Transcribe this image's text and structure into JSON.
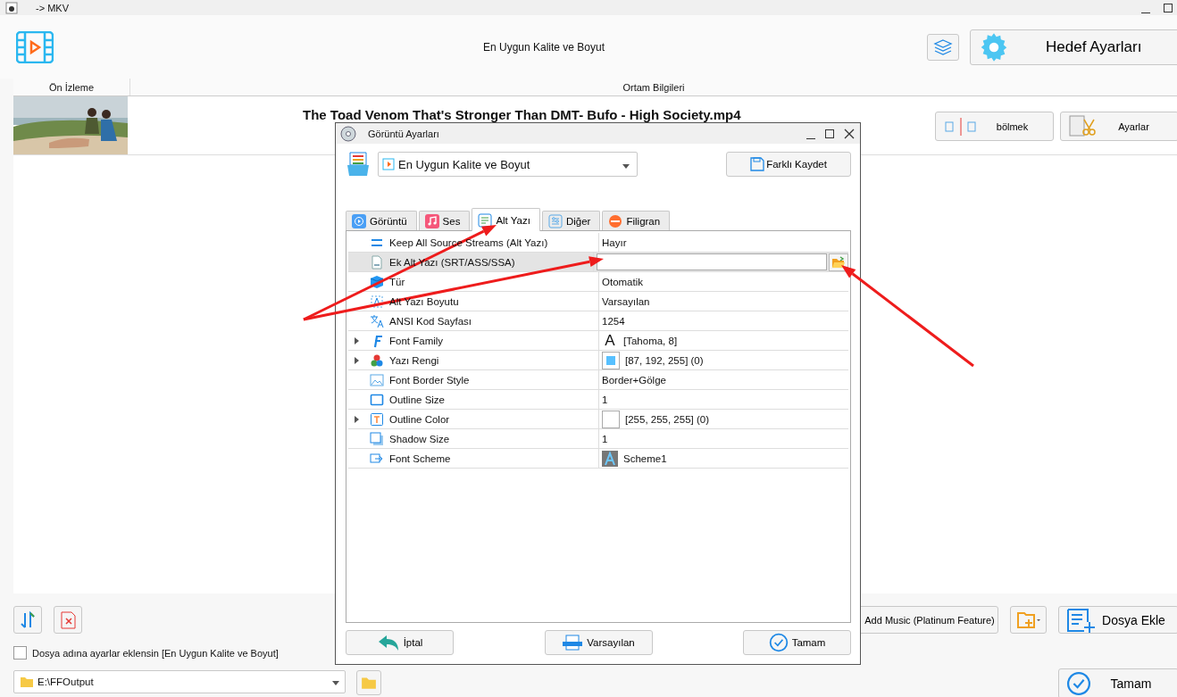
{
  "window": {
    "title": "-> MKV"
  },
  "header": {
    "profile": "En Uygun Kalite ve Boyut",
    "target_button": "Hedef Ayarları"
  },
  "table": {
    "columns": [
      "Ön İzleme",
      "Ortam Bilgileri"
    ],
    "rows": [
      {
        "preview": {
          "kind": "picture"
        },
        "file_name": "The Toad Venom That's Stronger Than DMT- Bufo - High Society.mp4",
        "actions": [
          "bölmek",
          "Ayarlar"
        ]
      }
    ]
  },
  "dialog": {
    "title": "Görüntü Ayarları",
    "preset": "En Uygun Kalite ve Boyut",
    "save_as": "Farklı Kaydet",
    "tabs": [
      {
        "label": "Görüntü",
        "selected": false
      },
      {
        "label": "Ses",
        "selected": false
      },
      {
        "label": "Alt Yazı",
        "selected": true
      },
      {
        "label": "Diğer",
        "selected": false
      },
      {
        "label": "Filigran",
        "selected": false
      }
    ],
    "properties": [
      {
        "kind": "text",
        "name": "Keep All Source Streams (Alt Yazı)",
        "value": "Hayır",
        "expandable": false,
        "selected": false
      },
      {
        "kind": "file",
        "name": "Ek Alt Yazı (SRT/ASS/SSA)",
        "expandable": false,
        "selected": true
      },
      {
        "kind": "text",
        "name": "Tür",
        "value": "Otomatik",
        "expandable": false,
        "selected": false
      },
      {
        "kind": "text",
        "name": "Alt Yazı Boyutu",
        "value": "Varsayılan",
        "expandable": false,
        "selected": false
      },
      {
        "kind": "text",
        "name": "ANSI Kod Sayfası",
        "value": "1254",
        "expandable": false,
        "selected": false
      },
      {
        "kind": "font",
        "name": "Font Family",
        "value": "[Tahoma, 8]",
        "glyph": "A",
        "expandable": true,
        "selected": false
      },
      {
        "kind": "swatch",
        "name": "Yazı Rengi",
        "value": "[87, 192, 255] (0)",
        "color": "#57c0ff",
        "expandable": true,
        "selected": false
      },
      {
        "kind": "text",
        "name": "Font Border Style",
        "value": "Border+Gölge",
        "expandable": false,
        "selected": false
      },
      {
        "kind": "text",
        "name": "Outline Size",
        "value": "1",
        "expandable": false,
        "selected": false
      },
      {
        "kind": "swatch",
        "name": "Outline Color",
        "value": "[255, 255, 255] (0)",
        "color": "#ffffff",
        "expandable": true,
        "selected": false
      },
      {
        "kind": "text",
        "name": "Shadow Size",
        "value": "1",
        "expandable": false,
        "selected": false
      },
      {
        "kind": "scheme",
        "name": "Font Scheme",
        "value": "Scheme1",
        "expandable": false,
        "selected": false
      }
    ],
    "buttons": [
      "İptal",
      "Varsayılan",
      "Tamam"
    ]
  },
  "bottom": {
    "add_music": "Add Music (Platinum Feature)",
    "add_file": "Dosya Ekle",
    "append_settings": {
      "label": "Dosya adına ayarlar eklensin [En Uygun Kalite ve Boyut]",
      "checked": false
    },
    "output_folder": "E:\\FFOutput",
    "ok": "Tamam"
  }
}
